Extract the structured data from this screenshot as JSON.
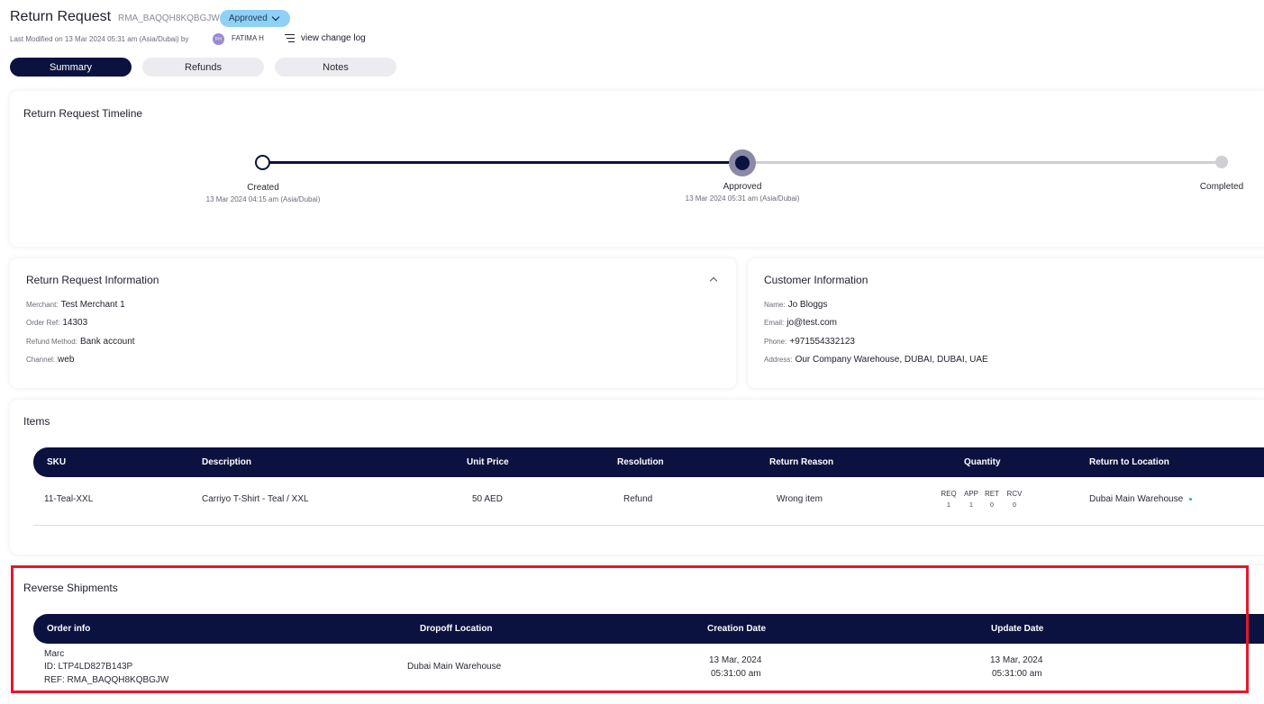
{
  "header": {
    "title": "Return Request",
    "rma": "RMA_BAQQH8KQBGJW",
    "status": "Approved",
    "last_modified": "Last Modified on 13 Mar 2024 05:31 am (Asia/Dubai) by",
    "user_initials": "FH",
    "user_name": "FATIMA H",
    "change_log_label": "view change log"
  },
  "tabs": [
    {
      "label": "Summary",
      "active": true
    },
    {
      "label": "Refunds",
      "active": false
    },
    {
      "label": "Notes",
      "active": false
    }
  ],
  "timeline": {
    "title": "Return Request Timeline",
    "steps": [
      {
        "label": "Created",
        "date": "13 Mar 2024 04:15 am (Asia/Dubai)"
      },
      {
        "label": "Approved",
        "date": "13 Mar 2024 05:31 am (Asia/Dubai)"
      },
      {
        "label": "Completed",
        "date": ""
      }
    ]
  },
  "return_info": {
    "title": "Return Request Information",
    "fields": [
      {
        "key": "Merchant:",
        "value": "Test Merchant 1"
      },
      {
        "key": "Order Ref:",
        "value": "14303"
      },
      {
        "key": "Refund Method:",
        "value": "Bank account"
      },
      {
        "key": "Channel:",
        "value": "web"
      }
    ]
  },
  "customer_info": {
    "title": "Customer Information",
    "fields": [
      {
        "key": "Name:",
        "value": "Jo Bloggs"
      },
      {
        "key": "Email:",
        "value": "jo@test.com"
      },
      {
        "key": "Phone:",
        "value": "+971554332123"
      },
      {
        "key": "Address:",
        "value": "Our Company Warehouse, DUBAI, DUBAI, UAE"
      }
    ]
  },
  "items": {
    "title": "Items",
    "columns": [
      "SKU",
      "Description",
      "Unit Price",
      "Resolution",
      "Return Reason",
      "Quantity",
      "Return to Location"
    ],
    "rows": [
      {
        "sku": "11-Teal-XXL",
        "description": "Carriyo T-Shirt - Teal / XXL",
        "unit_price": "50 AED",
        "resolution": "Refund",
        "return_reason": "Wrong item",
        "quantity_labels": [
          "REQ",
          "APP",
          "RET",
          "RCV"
        ],
        "quantity_values": [
          "1",
          "1",
          "0",
          "0"
        ],
        "location": "Dubai Main Warehouse"
      }
    ]
  },
  "reverse_shipments": {
    "title": "Reverse Shipments",
    "columns": [
      "Order info",
      "Dropoff Location",
      "Creation Date",
      "Update Date"
    ],
    "rows": [
      {
        "name": "Marc",
        "id": "ID: LTP4LD827B143P",
        "ref": "REF: RMA_BAQQH8KQBGJW",
        "dropoff": "Dubai Main Warehouse",
        "created_date": "13 Mar, 2024",
        "created_time": "05:31:00 am",
        "updated_date": "13 Mar, 2024",
        "updated_time": "05:31:00 am"
      }
    ]
  },
  "colors": {
    "navy": "#0b1240",
    "status_pill": "#8fd0f5",
    "highlight": "#e3182d",
    "location_dot": "#1ec27a"
  }
}
